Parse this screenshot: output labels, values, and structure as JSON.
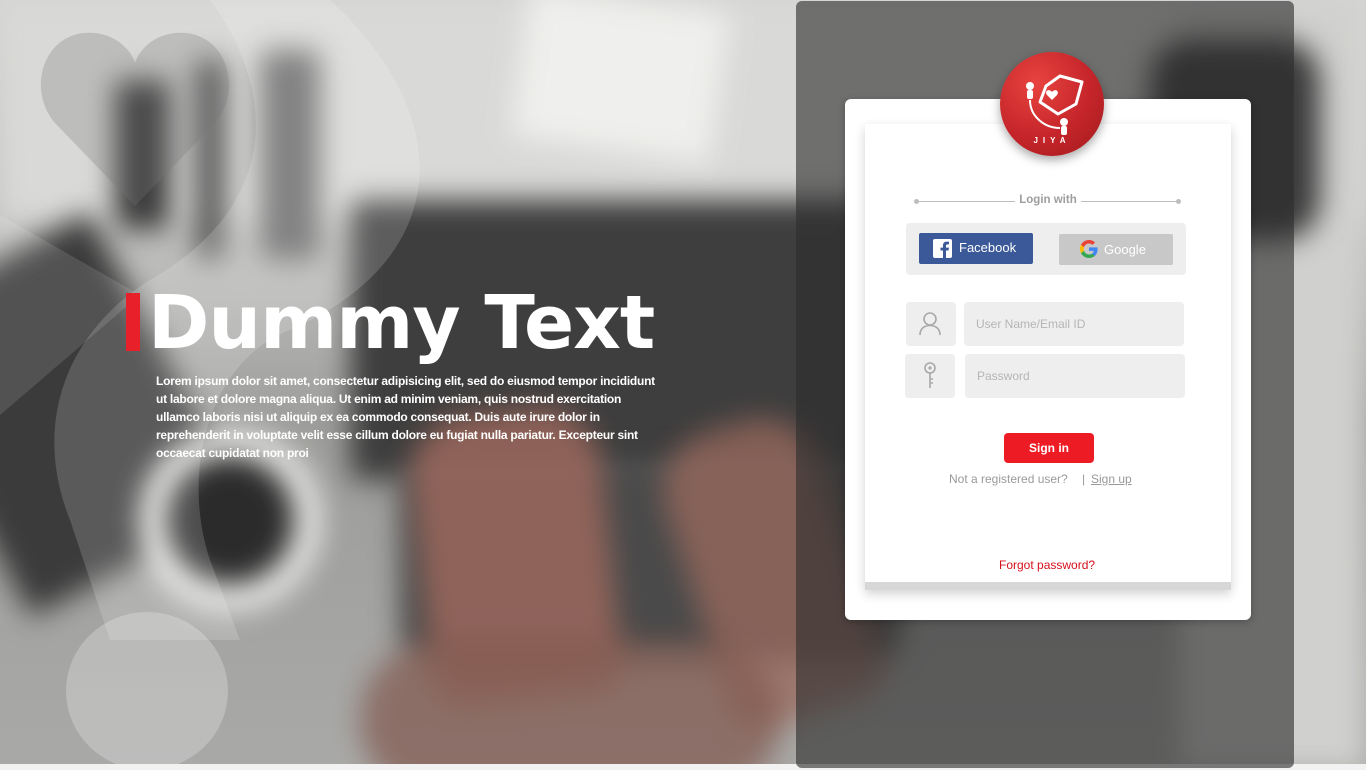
{
  "hero": {
    "title": "Dummy Text",
    "body": "Lorem ipsum dolor sit amet, consectetur adipisicing elit, sed do eiusmod tempor incididunt ut labore et dolore magna aliqua. Ut enim ad minim veniam, quis nostrud exercitation ullamco laboris nisi ut aliquip ex ea commodo consequat. Duis aute irure dolor in reprehenderit in voluptate velit esse cillum dolore eu fugiat nulla pariatur. Excepteur sint occaecat cupidatat non proi"
  },
  "logo": {
    "text": "JIYA"
  },
  "login": {
    "login_with": "Login with",
    "facebook_label": "Facebook",
    "google_label": "Google",
    "username_placeholder": "User Name/Email ID",
    "password_placeholder": "Password",
    "signin_label": "Sign in",
    "not_registered": "Not a registered user?",
    "separator": "|",
    "signup_label": "Sign up",
    "forgot_label": "Forgot password?"
  },
  "colors": {
    "accent_red": "#ed1c24",
    "facebook_blue": "#3b5998",
    "google_gray": "#c8c8c8"
  },
  "icons": {
    "facebook": "facebook-icon",
    "google": "google-icon",
    "user": "user-icon",
    "password": "key-icon",
    "logo": "pen-nib-logo"
  }
}
